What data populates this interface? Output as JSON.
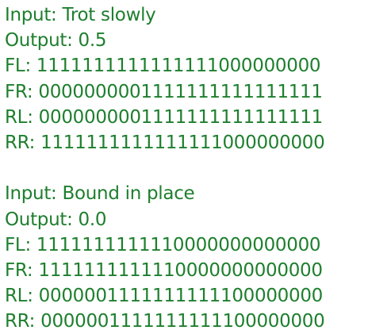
{
  "colors": {
    "text": "#1e7f2e",
    "background": "#ffffff"
  },
  "blocks": [
    {
      "input": "Input: Trot slowly",
      "output": "Output: 0.5",
      "fl": "FL: 1111111111111111000000000",
      "fr": "FR: 0000000001111111111111111",
      "rl": "RL: 0000000001111111111111111",
      "rr": "RR: 1111111111111111000000000"
    },
    {
      "input": "Input: Bound in place",
      "output": "Output: 0.0",
      "fl": "FL: 1111111111110000000000000",
      "fr": "FR: 1111111111110000000000000",
      "rl": "RL: 0000001111111111100000000",
      "rr": "RR: 0000001111111111100000000"
    }
  ]
}
